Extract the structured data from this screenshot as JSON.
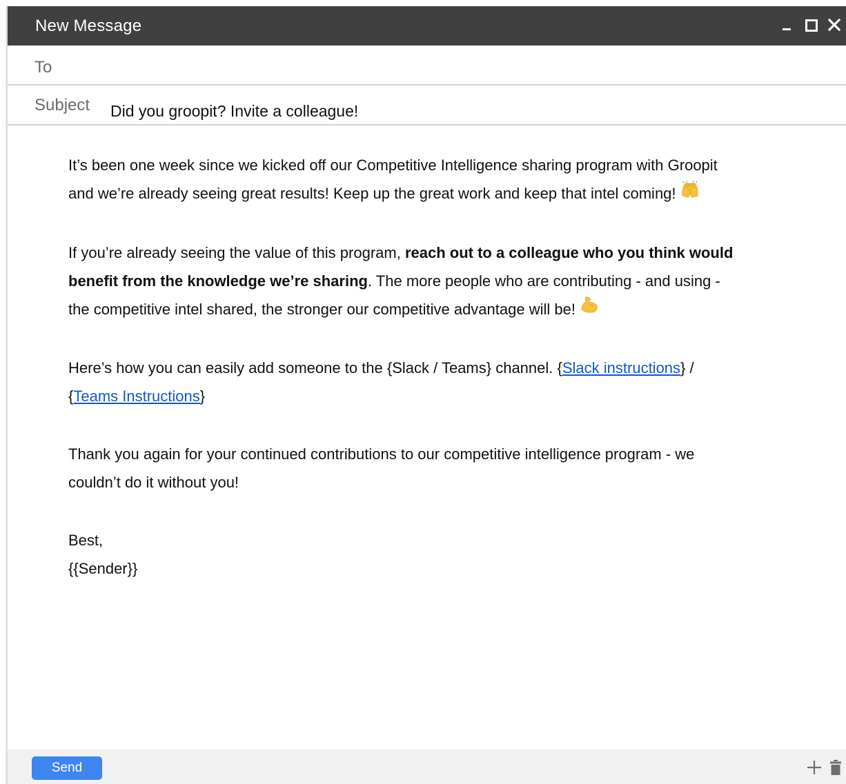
{
  "window": {
    "title": "New Message",
    "controls": [
      "minimize-icon",
      "maximize-icon",
      "close-icon"
    ]
  },
  "fields": {
    "to_label": "To",
    "to_value": "",
    "subject_label": "Subject",
    "subject_value": "Did you groopit? Invite a colleague!"
  },
  "body": {
    "p1_text": "It’s been one week since we kicked off our Competitive Intelligence sharing program with Groopit and we’re already seeing great results! Keep up the great work and keep that intel coming! ",
    "p1_emoji": "raising-hands-emoji",
    "p2_before": "If you’re already seeing the value of this program, ",
    "p2_bold": "reach out to a colleague who you think would benefit from the knowledge we’re sharing",
    "p2_after": ". The more people who are contributing - and using - the competitive intel shared, the stronger our competitive advantage will be!  ",
    "p2_emoji": "flexed-biceps-emoji",
    "p3_before": "Here’s how you can easily add someone to the {Slack / Teams} channel. {",
    "p3_link1": "Slack instructions",
    "p3_mid": "} / {",
    "p3_link2": "Teams Instructions",
    "p3_after": "}",
    "p4_text": "Thank you again for your continued contributions to our competitive intelligence program - we couldn’t do it without you!",
    "closing": "Best,",
    "signature": "{{Sender}}"
  },
  "footer": {
    "send_label": "Send",
    "icons": [
      "plus-icon",
      "trash-icon"
    ]
  },
  "colors": {
    "titlebar": "#404040",
    "send_button": "#3d85f0",
    "link": "#1155cc",
    "footer_bg": "#f1f1f1"
  }
}
